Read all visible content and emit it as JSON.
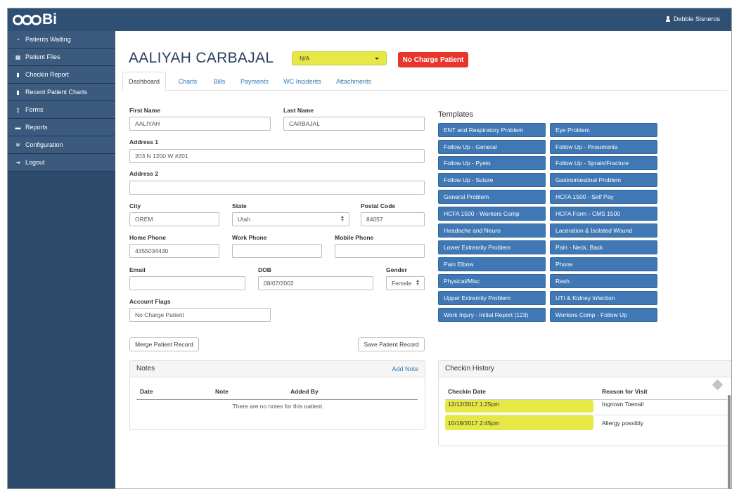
{
  "brand": {
    "logo_text": "Bi"
  },
  "user": {
    "name": "Debbie Sisneros"
  },
  "sidebar": {
    "items": [
      {
        "label": "Patients Waiting",
        "icon": "dashboard-icon"
      },
      {
        "label": "Patient Files",
        "icon": "table-icon"
      },
      {
        "label": "Checkin Report",
        "icon": "file-icon"
      },
      {
        "label": "Recent Patient Charts",
        "icon": "file-icon"
      },
      {
        "label": "Forms",
        "icon": "document-icon"
      },
      {
        "label": "Reports",
        "icon": "folder-icon"
      },
      {
        "label": "Configuration",
        "icon": "gear-icon"
      },
      {
        "label": "Logout",
        "icon": "logout-icon"
      }
    ]
  },
  "patient": {
    "name": "AALIYAH CARBAJAL",
    "flag_select": "N/A",
    "badge": "No Charge Patient"
  },
  "tabs": [
    "Dashboard",
    "Charts",
    "Bills",
    "Payments",
    "WC Incidents",
    "Attachments"
  ],
  "form": {
    "first_name_label": "First Name",
    "first_name": "AALIYAH",
    "last_name_label": "Last Name",
    "last_name": "CARBAJAL",
    "address1_label": "Address 1",
    "address1": "203 N 1200 W #201",
    "address2_label": "Address 2",
    "address2": "",
    "city_label": "City",
    "city": "OREM",
    "state_label": "State",
    "state": "Utah",
    "postal_label": "Postal Code",
    "postal": "84057",
    "home_phone_label": "Home Phone",
    "home_phone": "4355034430",
    "work_phone_label": "Work Phone",
    "work_phone": "",
    "mobile_phone_label": "Mobile Phone",
    "mobile_phone": "",
    "email_label": "Email",
    "email": "",
    "dob_label": "DOB",
    "dob": "08/07/2002",
    "gender_label": "Gender",
    "gender": "Female",
    "flags_label": "Account Flags",
    "flags": "No Charge Patient",
    "merge_button": "Merge Patient Record",
    "save_button": "Save Patient Record"
  },
  "templates": {
    "title": "Templates",
    "left": [
      "ENT and Respiratory Problem",
      "Follow Up - General",
      "Follow Up - Pyelo",
      "Follow Up - Suture",
      "General Problem",
      "HCFA 1500 - Workers Comp",
      "Headache and Neuro",
      "Lower Extremity Problem",
      "Pain Elbow",
      "Physical/Misc",
      "Upper Extremity Problem",
      "Work Injury - Initial Report (123)"
    ],
    "right": [
      "Eye Problem",
      "Follow Up - Pneumonia",
      "Follow Up - Sprain/Fracture",
      "Gastrointestinal Problem",
      "HCFA 1500 - Self Pay",
      "HCFA Form - CMS 1500",
      "Laceration & Isolated Wound",
      "Pain - Neck, Back",
      "Phone",
      "Rash",
      "UTI & Kidney Infection",
      "Workers Comp - Follow Up"
    ]
  },
  "notes": {
    "title": "Notes",
    "add_label": "Add Note",
    "columns": [
      "Date",
      "Note",
      "Added By"
    ],
    "empty_text": "There are no notes for this patient."
  },
  "checkin": {
    "title": "Checkin History",
    "columns": [
      "Checkin Date",
      "Reason for Visit"
    ],
    "rows": [
      {
        "date": "12/12/2017 1:25pm",
        "reason": "Ingrown Toenail"
      },
      {
        "date": "10/18/2017 2:45pm",
        "reason": "Allergy possibly"
      }
    ]
  },
  "colors": {
    "topbar": "#2f4f73",
    "sidebar": "#3c5a7e",
    "template_button": "#3f78b5",
    "highlight": "#e6e845",
    "badge": "#e8352c"
  }
}
